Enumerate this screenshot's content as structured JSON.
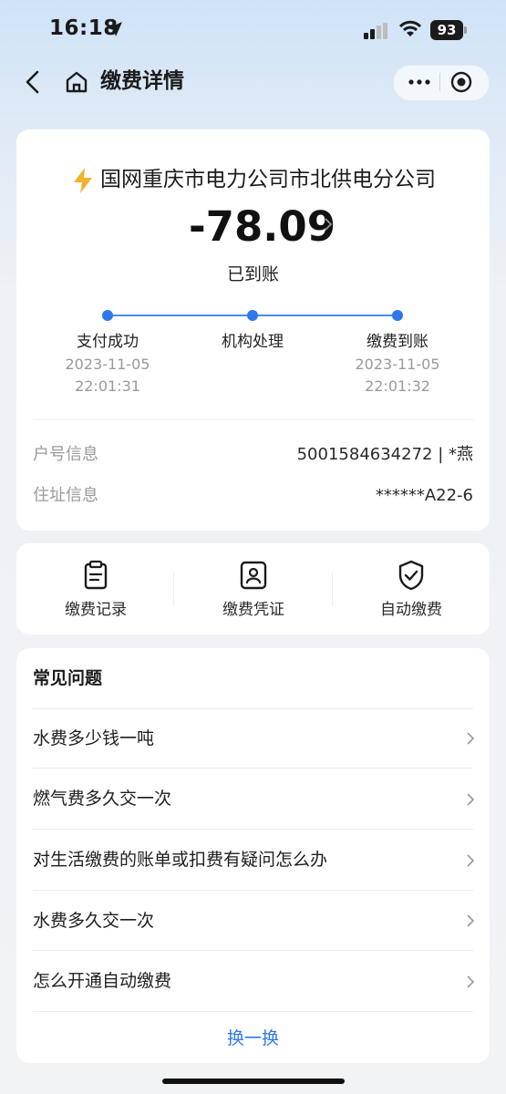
{
  "status_bar": {
    "time": "16:18",
    "battery": "93"
  },
  "nav": {
    "title": "缴费详情"
  },
  "payment": {
    "company": "国网重庆市电力公司市北供电分公司",
    "amount": "-78.09",
    "status": "已到账",
    "steps": [
      {
        "label": "支付成功",
        "date": "2023-11-05",
        "time": "22:01:31"
      },
      {
        "label": "机构处理",
        "date": "",
        "time": ""
      },
      {
        "label": "缴费到账",
        "date": "2023-11-05",
        "time": "22:01:32"
      }
    ],
    "info": [
      {
        "label": "户号信息",
        "value": "5001584634272 | *燕"
      },
      {
        "label": "住址信息",
        "value": "******A22-6"
      }
    ]
  },
  "actions": [
    {
      "label": "缴费记录",
      "icon": "clipboard-icon"
    },
    {
      "label": "缴费凭证",
      "icon": "id-card-icon"
    },
    {
      "label": "自动缴费",
      "icon": "shield-check-icon"
    }
  ],
  "faq": {
    "title": "常见问题",
    "items": [
      "水费多少钱一吨",
      "燃气费多久交一次",
      "对生活缴费的账单或扣费有疑问怎么办",
      "水费多久交一次",
      "怎么开通自动缴费"
    ],
    "refresh_label": "换一换"
  },
  "colors": {
    "accent": "#2f78ec",
    "bolt": "#f5b02c"
  }
}
